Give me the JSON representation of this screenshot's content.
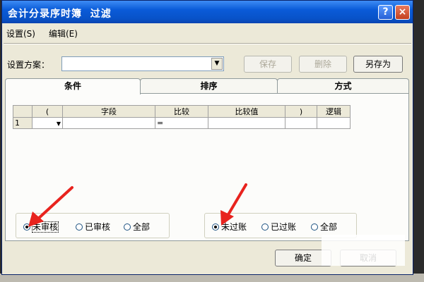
{
  "window": {
    "title": "会计分录序时簿  过滤",
    "help_label": "?",
    "close_label": "×"
  },
  "menu": [
    {
      "label": "设置(S)"
    },
    {
      "label": "编辑(E)"
    }
  ],
  "scheme": {
    "label": "设置方案：",
    "value": "",
    "save_label": "保存",
    "delete_label": "删除",
    "save_as_label": "另存为"
  },
  "tabs": [
    {
      "label": "条件",
      "active": true
    },
    {
      "label": "排序",
      "active": false
    },
    {
      "label": "方式",
      "active": false
    }
  ],
  "grid": {
    "headers": [
      "",
      "(",
      "字段",
      "比较",
      "比较值",
      ")",
      "逻辑"
    ],
    "rows": [
      {
        "num": "1",
        "paren_open": "",
        "field": "",
        "compare": "=",
        "value": "",
        "paren_close": "",
        "logic": ""
      }
    ]
  },
  "audit_group": {
    "options": [
      {
        "label": "未审核",
        "selected": true
      },
      {
        "label": "已审核",
        "selected": false
      },
      {
        "label": "全部",
        "selected": false
      }
    ]
  },
  "posting_group": {
    "options": [
      {
        "label": "未过账",
        "selected": true
      },
      {
        "label": "已过账",
        "selected": false
      },
      {
        "label": "全部",
        "selected": false
      }
    ]
  },
  "footer": {
    "ok_label": "确定",
    "cancel_label": "取消"
  },
  "colors": {
    "titlebar": "#0852c8",
    "dialog_bg": "#ece9d8",
    "annotation_arrow": "#e8231e"
  }
}
